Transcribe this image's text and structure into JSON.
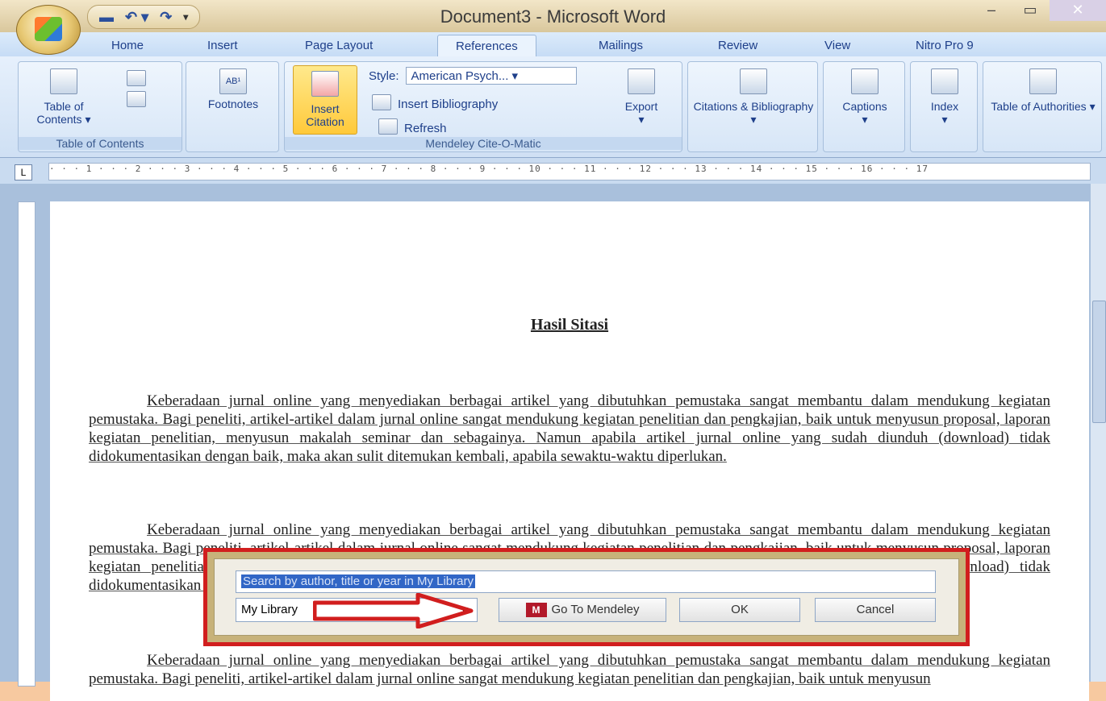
{
  "window": {
    "title": "Document3 - Microsoft Word",
    "min": "–",
    "max": "▭",
    "close": "✕"
  },
  "tabs": [
    "Home",
    "Insert",
    "Page Layout",
    "References",
    "Mailings",
    "Review",
    "View",
    "Nitro Pro 9"
  ],
  "ribbon": {
    "toc": {
      "button": "Table of Contents ▾",
      "group": "Table of Contents"
    },
    "footnotes": {
      "button": "Footnotes",
      "icon_text": "AB¹"
    },
    "mendeley": {
      "insert_citation": "Insert Citation",
      "style_label": "Style:",
      "style_value": "American Psych...",
      "insert_bibliography": "Insert Bibliography",
      "refresh": "Refresh",
      "export": "Export",
      "group": "Mendeley Cite-O-Matic"
    },
    "citations": "Citations & Bibliography ▾",
    "captions": "Captions",
    "index": "Index",
    "authorities": "Table of Authorities ▾"
  },
  "ruler": "· · · 1 · · · 2 · · · 3 · · · 4 · · · 5 · · · 6 · · · 7 · · · 8 · · · 9 · · · 10 · · · 11 · · · 12 · · · 13 · · · 14 · · · 15 · · · 16 · · · 17",
  "document": {
    "heading": "Hasil Sitasi",
    "paragraphs": [
      "Keberadaan jurnal online yang menyediakan berbagai artikel yang dibutuhkan pemustaka sangat membantu dalam mendukung kegiatan pemustaka. Bagi peneliti, artikel-artikel dalam jurnal online sangat mendukung kegiatan penelitian dan pengkajian, baik untuk menyusun proposal, laporan kegiatan penelitian, menyusun makalah seminar dan sebagainya. Namun apabila artikel jurnal online yang sudah diunduh (download) tidak didokumentasikan dengan baik, maka akan sulit ditemukan kembali, apabila sewaktu-waktu diperlukan.",
      "Keberadaan jurnal online yang menyediakan berbagai artikel yang dibutuhkan pemustaka sangat membantu dalam mendukung kegiatan pemustaka. Bagi peneliti, artikel-artikel dalam jurnal online sangat mendukung kegiatan penelitian dan pengkajian, baik untuk menyusun proposal, laporan kegiatan penelitian, menyusun makalah seminar dan sebagainya. Namun apabila artikel jurnal online yang sudah diunduh (download) tidak didokumentasikan dengan baik, maka akan sulit ditemukan kembali, apabila sewaktu-waktu diperlukan.",
      "Keberadaan jurnal online yang menyediakan berbagai artikel yang dibutuhkan pemustaka sangat membantu dalam mendukung kegiatan pemustaka. Bagi peneliti, artikel-artikel dalam jurnal online sangat mendukung kegiatan penelitian dan pengkajian, baik untuk menyusun"
    ]
  },
  "dialog": {
    "search_value": "Search by author, title or year in My Library",
    "library_select": "My Library",
    "go_to_mendeley": "Go To Mendeley",
    "mendeley_logo": "M",
    "ok": "OK",
    "cancel": "Cancel"
  },
  "colors": {
    "highlight": "#d11e1e",
    "ribbon": "#cfe0f4"
  }
}
